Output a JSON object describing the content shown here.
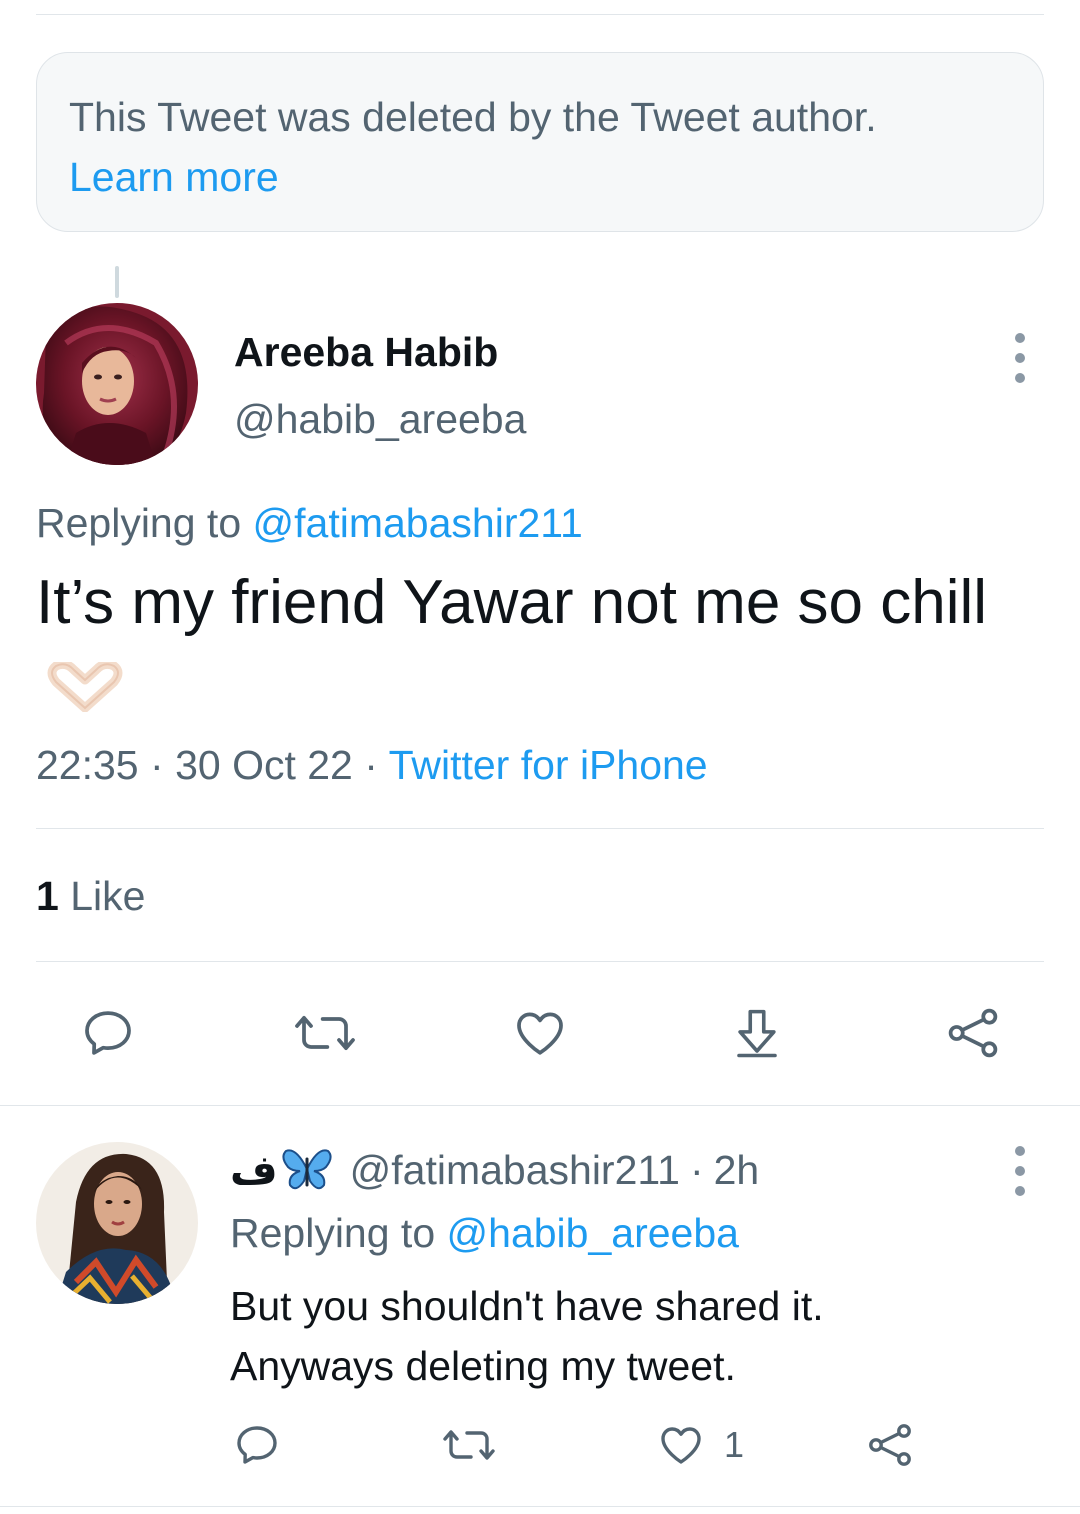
{
  "deleted_notice": {
    "text": "This Tweet was deleted by the Tweet author.",
    "link": "Learn more"
  },
  "tweet": {
    "author_name": "Areeba Habib",
    "author_handle": "@habib_areeba",
    "replying_prefix": "Replying to",
    "replying_to": "@fatimabashir211",
    "text": "It’s my friend Yawar not me so chill",
    "emoji": "heart-hands-emoji",
    "time": "22:35",
    "date": "30 Oct 22",
    "separator": "·",
    "source": "Twitter for iPhone",
    "like_count": "1",
    "like_label": "Like",
    "actions": [
      "reply-icon",
      "retweet-icon",
      "like-icon",
      "bookmark-download-icon",
      "share-icon"
    ]
  },
  "reply": {
    "display_name": "ف",
    "display_emoji": "butterfly-emoji",
    "handle": "@fatimabashir211",
    "separator": "·",
    "age": "2h",
    "replying_prefix": "Replying to",
    "replying_to": "@habib_areeba",
    "text_line1": "But you shouldn't have shared it.",
    "text_line2": "Anyways deleting my tweet.",
    "like_count": "1",
    "actions": [
      "reply-icon",
      "retweet-icon",
      "like-icon",
      "share-icon"
    ]
  },
  "colors": {
    "text_primary": "#0f1419",
    "text_secondary": "#536471",
    "link": "#1d9bf0",
    "divider": "#e1e6ea",
    "notice_bg": "#f6f8f9"
  }
}
